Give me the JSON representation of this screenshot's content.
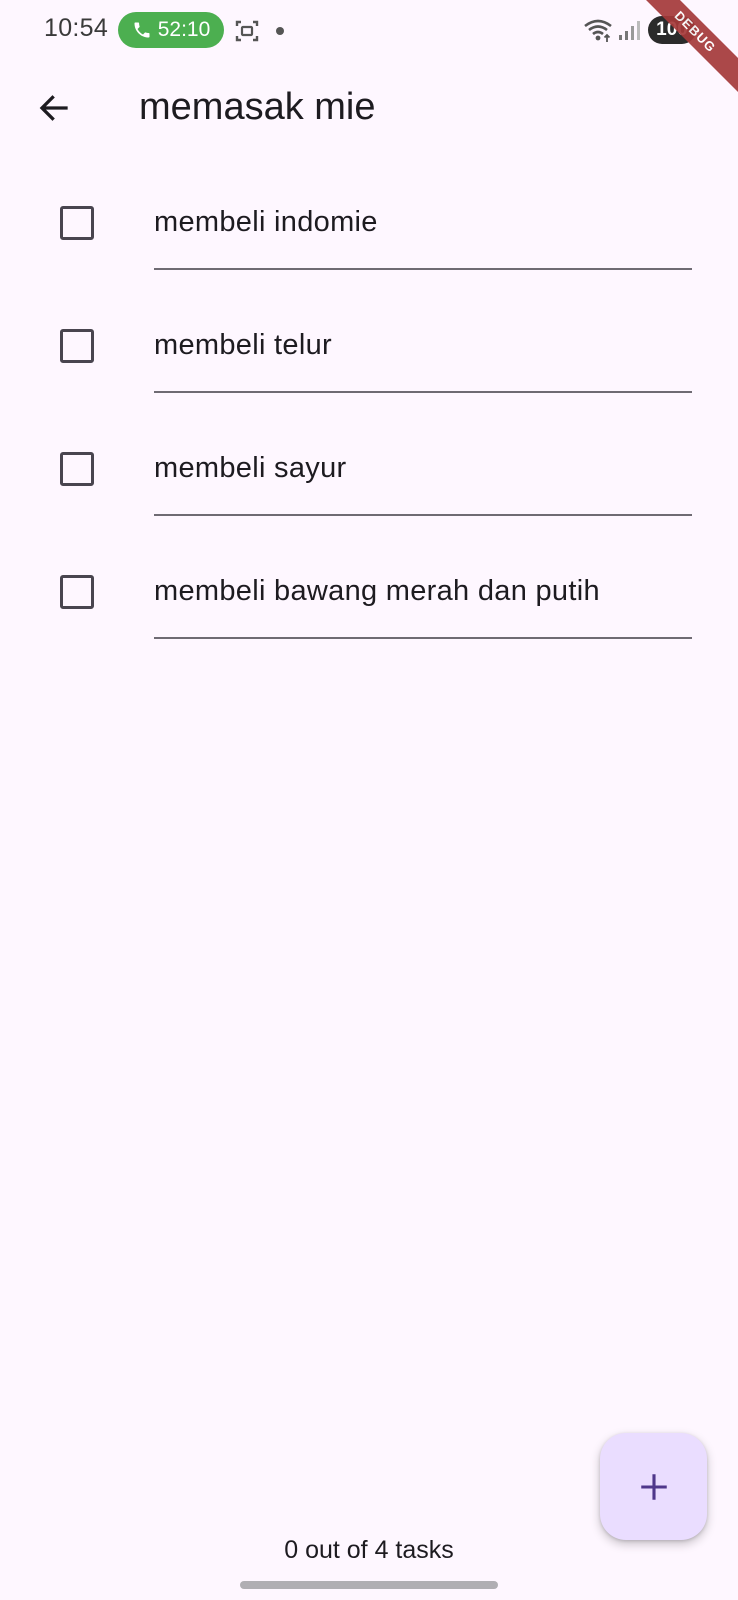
{
  "status_bar": {
    "time": "10:54",
    "call_duration": "52:10",
    "battery": "100",
    "call_color": "#4CAF50"
  },
  "debug_banner": "DEBUG",
  "app_bar": {
    "title": "memasak mie",
    "back_icon": "arrow-back-icon"
  },
  "tasks": [
    {
      "label": "membeli indomie",
      "checked": false
    },
    {
      "label": "membeli telur",
      "checked": false
    },
    {
      "label": "membeli sayur",
      "checked": false
    },
    {
      "label": "membeli bawang merah dan putih",
      "checked": false
    }
  ],
  "fab": {
    "icon": "add-icon",
    "color": "#EADDFF"
  },
  "footer": {
    "counter": "0 out of 4 tasks"
  },
  "colors": {
    "background": "#FEF7FF",
    "primary_text": "#1D1B20",
    "checkbox_border": "#49454F",
    "fab_icon": "#4F378B"
  }
}
